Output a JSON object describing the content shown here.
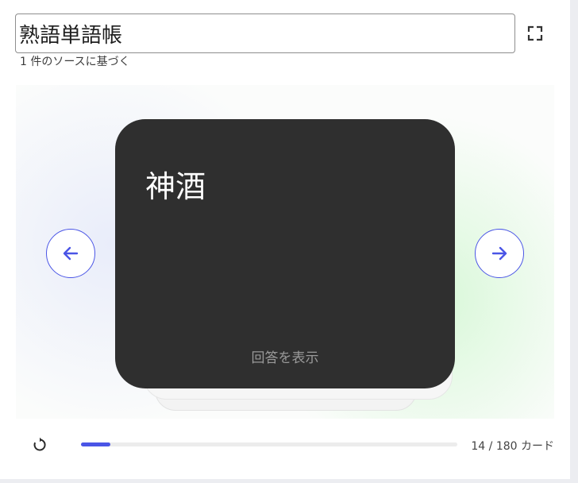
{
  "header": {
    "title_value": "熟語単語帳",
    "source_note": "1 件のソースに基づく",
    "fullscreen_icon": "fullscreen-icon"
  },
  "card": {
    "term": "神酒",
    "hint": "回答を表示",
    "background": "#2f2f2f"
  },
  "navigation": {
    "prev_icon": "arrow-left-icon",
    "next_icon": "arrow-right-icon",
    "accent": "#4a55e6"
  },
  "footer": {
    "reset_icon": "refresh-icon",
    "current": 14,
    "total": 180,
    "counter_text": "14 / 180 カード",
    "progress_fraction": 0.078
  }
}
